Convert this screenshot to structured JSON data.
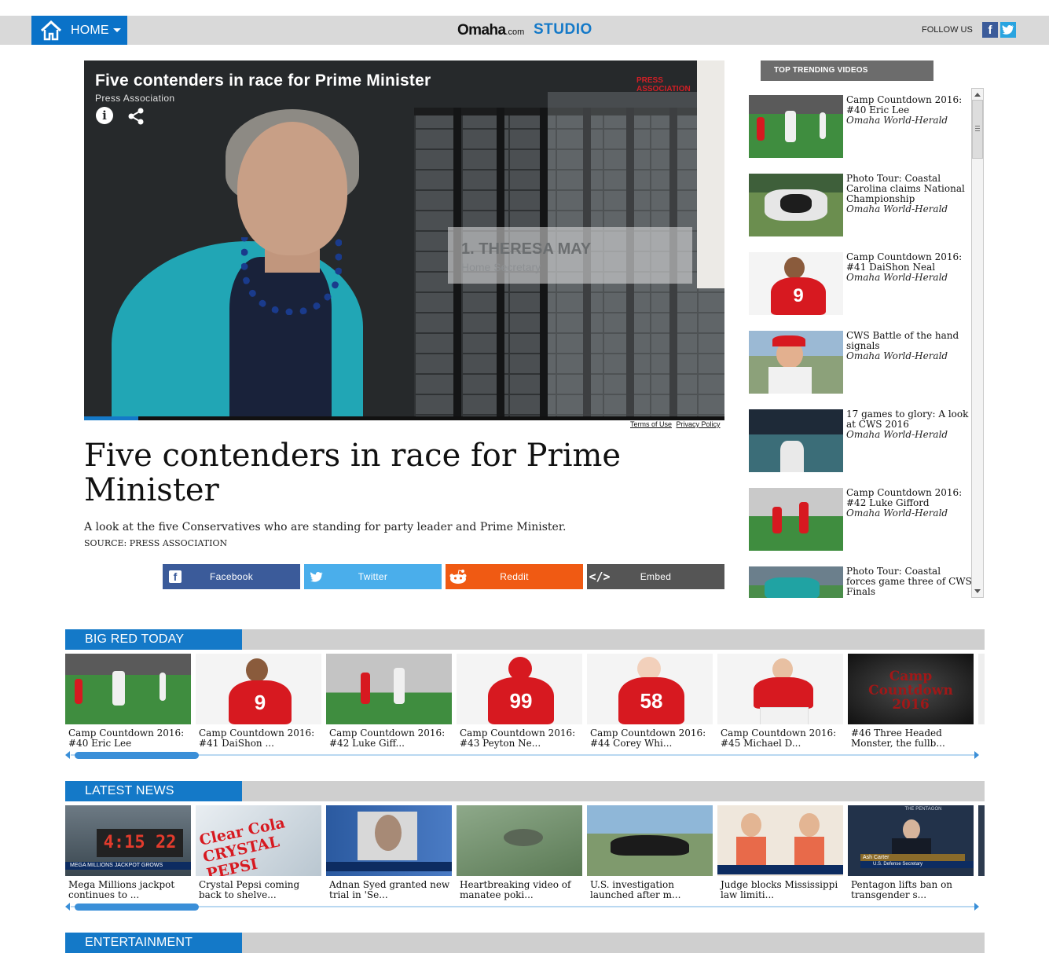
{
  "header": {
    "home_label": "HOME",
    "logo_main": "Omaha",
    "logo_suffix": ".com",
    "studio_label": "STUDIO",
    "follow_label": "FOLLOW US"
  },
  "video": {
    "title": "Five contenders in race for Prime Minister",
    "source": "Press Association",
    "watermark": "PRESS ASSOCIATION",
    "lower_third_name": "1. THERESA MAY",
    "lower_third_role": "Home Secretary",
    "progress": 0.085,
    "terms_label": "Terms of Use",
    "privacy_label": "Privacy Policy"
  },
  "article": {
    "headline": "Five contenders in race for Prime Minister",
    "description": "A look at the five Conservatives who are standing for party leader and Prime Minister.",
    "source": "SOURCE: PRESS ASSOCIATION"
  },
  "share": {
    "facebook": "Facebook",
    "twitter": "Twitter",
    "reddit": "Reddit",
    "embed": "Embed"
  },
  "trending": {
    "heading": "TOP TRENDING VIDEOS",
    "items": [
      {
        "title": "Camp Countdown 2016: #40 Eric Lee",
        "source": "Omaha World-Herald"
      },
      {
        "title": "Photo Tour: Coastal Carolina claims National Championship",
        "source": "Omaha World-Herald"
      },
      {
        "title": "Camp Countdown 2016: #41 DaiShon Neal",
        "source": "Omaha World-Herald"
      },
      {
        "title": "CWS Battle of the hand signals",
        "source": "Omaha World-Herald"
      },
      {
        "title": "17 games to glory: A look at CWS 2016",
        "source": "Omaha World-Herald"
      },
      {
        "title": "Camp Countdown 2016: #42 Luke Gifford",
        "source": "Omaha World-Herald"
      },
      {
        "title": "Photo Tour: Coastal forces game three of CWS Finals",
        "source": ""
      }
    ]
  },
  "big_red": {
    "heading": "BIG RED TODAY",
    "cards": [
      {
        "title": "Camp Countdown 2016: #40 Eric Lee"
      },
      {
        "title": "Camp Countdown 2016: #41 DaiShon ..."
      },
      {
        "title": "Camp Countdown 2016: #42 Luke Giff..."
      },
      {
        "title": "Camp Countdown 2016: #43 Peyton Ne..."
      },
      {
        "title": "Camp Countdown 2016: #44 Corey Whi..."
      },
      {
        "title": "Camp Countdown 2016: #45 Michael D..."
      },
      {
        "title": "#46 Three Headed Monster, the fullb..."
      }
    ],
    "jersey_numbers": [
      "9",
      "99",
      "58"
    ],
    "promo_text": "Camp Countdown 2016"
  },
  "latest_news": {
    "heading": "LATEST NEWS",
    "cards": [
      {
        "title": "Mega Millions jackpot continues to ..."
      },
      {
        "title": "Crystal Pepsi coming back to shelve..."
      },
      {
        "title": "Adnan Syed granted new trial in 'Se..."
      },
      {
        "title": "Heartbreaking video of manatee poki..."
      },
      {
        "title": "U.S. investigation launched after m..."
      },
      {
        "title": "Judge blocks Mississippi law limiti..."
      },
      {
        "title": "Pentagon lifts ban on transgender s..."
      }
    ],
    "thumb_text": {
      "mega_caption": "MEGA MILLIONS JACKPOT GROWS",
      "mega_numbers": "4:15 22",
      "crystal": "Clear Cola CRYSTAL PEPSI",
      "pentagon": "THE PENTAGON",
      "ash_name": "Ash Carter",
      "ash_title": "U.S. Defense Secretary"
    }
  },
  "entertainment": {
    "heading": "ENTERTAINMENT"
  },
  "colors": {
    "accent": "#1479c8",
    "facebook": "#3b5b9a",
    "twitter": "#4aaeeb",
    "reddit": "#f05a13",
    "embed": "#555555",
    "nebraska_red": "#d71920"
  }
}
